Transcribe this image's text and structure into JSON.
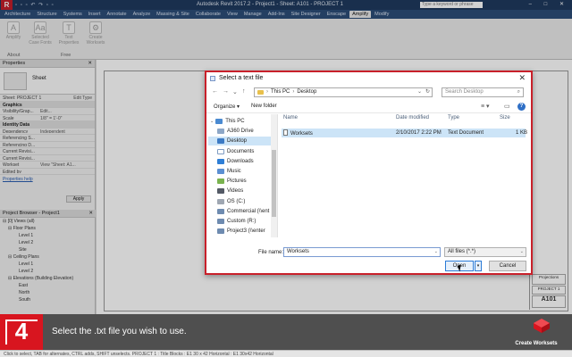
{
  "app": {
    "logo_letter": "R",
    "quick_access": "▫ ▫ ▫ ↶ ↷ ▫ ▫",
    "title": "Autodesk Revit 2017.2 -   Project1 - Sheet: A101 - PROJECT 1",
    "search_placeholder": "Type a keyword or phrase",
    "window_controls": "– □ ✕"
  },
  "ribbon": {
    "tabs": [
      "Architecture",
      "Structure",
      "Systems",
      "Insert",
      "Annotate",
      "Analyze",
      "Massing & Site",
      "Collaborate",
      "View",
      "Manage",
      "Add-Ins",
      "Site Designer",
      "Enscape",
      "Amplify",
      "Modify"
    ],
    "active_tab_index": 13,
    "buttons": [
      {
        "label": "Amplify",
        "glyph": "A"
      },
      {
        "label": "Selected\nCase Fonts",
        "glyph": "Aa"
      },
      {
        "label": "Text\nProperties",
        "glyph": "T"
      },
      {
        "label": "Create\nWorksets",
        "glyph": "⚙"
      }
    ],
    "panels": [
      "About",
      "Free"
    ]
  },
  "properties": {
    "title": "Properties",
    "type_name": "Sheet",
    "selector": "Sheet: PROJECT 1",
    "edit_type": "Edit Type",
    "rows": [
      {
        "section": "Graphics"
      },
      {
        "k": "Visibility/Grap...",
        "v": "Edit..."
      },
      {
        "k": "Scale",
        "v": "1/8\" = 1'-0\""
      },
      {
        "section": "Identity Data"
      },
      {
        "k": "Dependency",
        "v": "Independent"
      },
      {
        "k": "Referencing S...",
        "v": ""
      },
      {
        "k": "Referencing D...",
        "v": ""
      },
      {
        "k": "Current Revisi...",
        "v": ""
      },
      {
        "k": "Current Revisi...",
        "v": ""
      },
      {
        "k": "Workset",
        "v": "View \"Sheet: A1..."
      },
      {
        "k": "Edited by",
        "v": ""
      }
    ],
    "help_link": "Properties help",
    "apply": "Apply"
  },
  "browser": {
    "title": "Project Browser - Project1",
    "nodes": [
      {
        "label": "⊟ [0] Views (all)",
        "indent": 0
      },
      {
        "label": "⊟ Floor Plans",
        "indent": 1
      },
      {
        "label": "Level 1",
        "indent": 3
      },
      {
        "label": "Level 2",
        "indent": 3
      },
      {
        "label": "Site",
        "indent": 3
      },
      {
        "label": "⊟ Ceiling Plans",
        "indent": 1
      },
      {
        "label": "Level 1",
        "indent": 3
      },
      {
        "label": "Level 2",
        "indent": 3
      },
      {
        "label": "⊟ Elevations (Building Elevation)",
        "indent": 1
      },
      {
        "label": "East",
        "indent": 3
      },
      {
        "label": "North",
        "indent": 3
      },
      {
        "label": "South",
        "indent": 3
      }
    ]
  },
  "sheet": {
    "title_block": [
      "Projections",
      "PROJECT 1",
      "A101"
    ]
  },
  "statusbar": "Click to select, TAB for alternates, CTRL adds, SHIFT unselects.    PROJECT 1 : Title Blocks : E1 30 x 42 Horizontal : E1 30x42 Horizontal",
  "dialog": {
    "title": "Select a text file",
    "close": "✕",
    "nav": {
      "back": "←",
      "forward": "→",
      "up_list": "⌄",
      "up": "↑"
    },
    "address": [
      "This PC",
      "Desktop"
    ],
    "address_dropdown": "⌄",
    "refresh": "↻",
    "search_placeholder": "Search Desktop",
    "search_icon": "⌕",
    "toolbar": {
      "organize": "Organize ▾",
      "new_folder": "New folder",
      "view_options": "≡ ▾",
      "preview_pane": "▭",
      "help": "?"
    },
    "nav_pane": [
      {
        "label": "This PC",
        "icon": "pc-icon",
        "class": "ico-pc",
        "arrow": "⌄",
        "indent": 0
      },
      {
        "label": "A360 Drive",
        "icon": "cloud-icon",
        "class": "ico-cloud",
        "arrow": "",
        "indent": 1
      },
      {
        "label": "Desktop",
        "icon": "desktop-icon",
        "class": "ico-desk",
        "arrow": "",
        "indent": 1,
        "selected": true
      },
      {
        "label": "Documents",
        "icon": "documents-icon",
        "class": "ico-doc",
        "arrow": "",
        "indent": 1
      },
      {
        "label": "Downloads",
        "icon": "downloads-icon",
        "class": "ico-down",
        "arrow": "",
        "indent": 1
      },
      {
        "label": "Music",
        "icon": "music-icon",
        "class": "ico-music",
        "arrow": "",
        "indent": 1
      },
      {
        "label": "Pictures",
        "icon": "pictures-icon",
        "class": "ico-pic",
        "arrow": "",
        "indent": 1
      },
      {
        "label": "Videos",
        "icon": "videos-icon",
        "class": "ico-vid",
        "arrow": "",
        "indent": 1
      },
      {
        "label": "OS (C:)",
        "icon": "drive-icon",
        "class": "ico-drive",
        "arrow": "",
        "indent": 1
      },
      {
        "label": "Commercial (\\\\ent",
        "icon": "network-drive-icon",
        "class": "ico-net",
        "arrow": "",
        "indent": 1
      },
      {
        "label": "Custom (R:)",
        "icon": "network-drive-icon",
        "class": "ico-net",
        "arrow": "",
        "indent": 1
      },
      {
        "label": "Project3 (\\\\enter",
        "icon": "network-drive-icon",
        "class": "ico-net",
        "arrow": "",
        "indent": 1
      }
    ],
    "columns": [
      "Name",
      "Date modified",
      "Type",
      "Size"
    ],
    "files": [
      {
        "name": "Worksets",
        "date": "2/10/2017 2:22 PM",
        "type": "Text Document",
        "size": "1 KB"
      }
    ],
    "file_name_label": "File name:",
    "file_name_value": "Worksets",
    "filter_value": "All files (*.*)",
    "open": "Open",
    "cancel": "Cancel"
  },
  "tutorial": {
    "step_number": "4",
    "instruction": "Select the .txt file you wish to use.",
    "brand": "Create Worksets",
    "accent_color": "#d8151f"
  }
}
